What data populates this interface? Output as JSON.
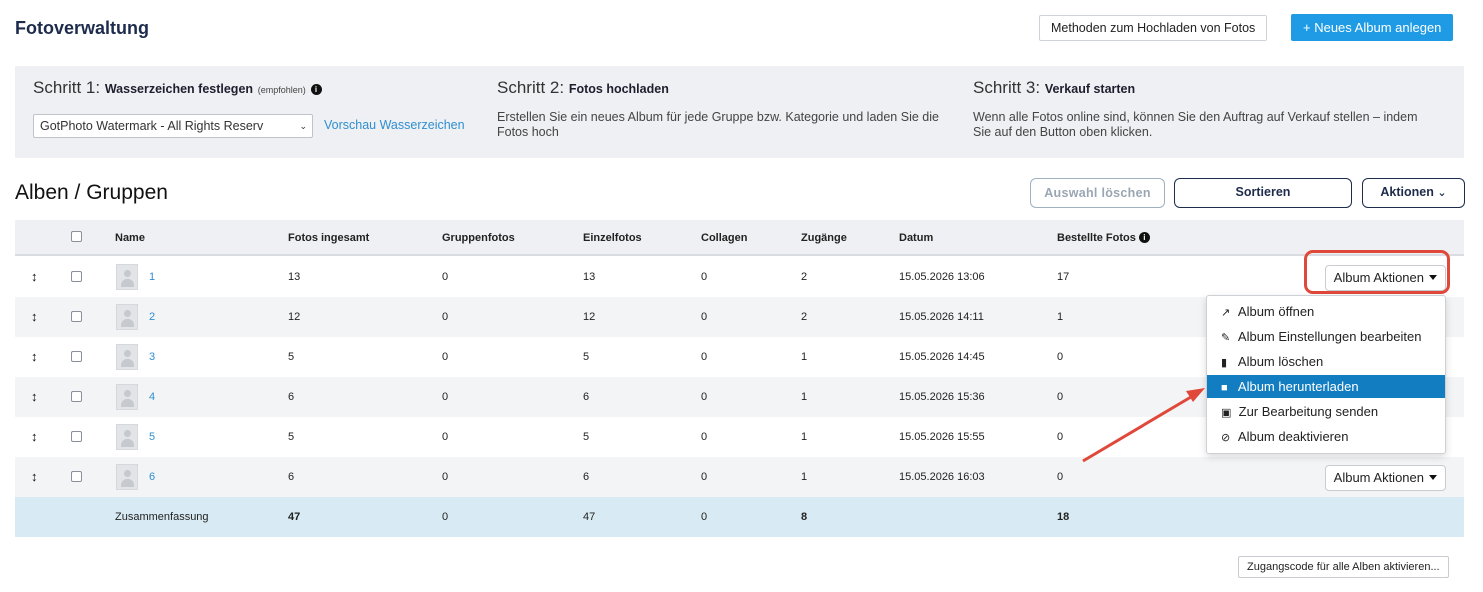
{
  "header": {
    "title": "Fotoverwaltung",
    "upload_methods_label": "Methoden zum Hochladen von Fotos",
    "new_album_label": "+ Neues Album anlegen"
  },
  "steps": [
    {
      "prefix": "Schritt 1:",
      "title": "Wasserzeichen festlegen",
      "note": "(empfohlen)"
    },
    {
      "prefix": "Schritt 2:",
      "title": "Fotos hochladen",
      "text": "Erstellen Sie ein neues Album für jede Gruppe bzw. Kategorie und laden Sie die Fotos hoch"
    },
    {
      "prefix": "Schritt 3:",
      "title": "Verkauf starten",
      "text": "Wenn alle Fotos online sind, können Sie den Auftrag auf Verkauf stellen – indem Sie auf den Button oben klicken."
    }
  ],
  "watermark": {
    "selected": "GotPhoto Watermark - All Rights Reserv",
    "preview_link": "Vorschau Wasserzeichen"
  },
  "albums": {
    "title": "Alben / Gruppen",
    "clear_selection_label": "Auswahl löschen",
    "sort_label": "Sortieren",
    "actions_label": "Aktionen"
  },
  "table": {
    "columns": [
      "Name",
      "Fotos ingesamt",
      "Gruppenfotos",
      "Einzelfotos",
      "Collagen",
      "Zugänge",
      "Datum",
      "Bestellte Fotos"
    ],
    "rows": [
      {
        "name": "1",
        "total": "13",
        "group": "0",
        "single": "13",
        "collages": "0",
        "access": "2",
        "date": "15.05.2026 13:06",
        "ordered": "17"
      },
      {
        "name": "2",
        "total": "12",
        "group": "0",
        "single": "12",
        "collages": "0",
        "access": "2",
        "date": "15.05.2026 14:11",
        "ordered": "1"
      },
      {
        "name": "3",
        "total": "5",
        "group": "0",
        "single": "5",
        "collages": "0",
        "access": "1",
        "date": "15.05.2026 14:45",
        "ordered": "0"
      },
      {
        "name": "4",
        "total": "6",
        "group": "0",
        "single": "6",
        "collages": "0",
        "access": "1",
        "date": "15.05.2026 15:36",
        "ordered": "0"
      },
      {
        "name": "5",
        "total": "5",
        "group": "0",
        "single": "5",
        "collages": "0",
        "access": "1",
        "date": "15.05.2026 15:55",
        "ordered": "0"
      },
      {
        "name": "6",
        "total": "6",
        "group": "0",
        "single": "6",
        "collages": "0",
        "access": "1",
        "date": "15.05.2026 16:03",
        "ordered": "0"
      }
    ],
    "summary": {
      "label": "Zusammenfassung",
      "total": "47",
      "group": "0",
      "single": "47",
      "collages": "0",
      "access": "8",
      "ordered": "18"
    },
    "album_actions_label": "Album Aktionen"
  },
  "album_menu": {
    "items": [
      {
        "label": "Album öffnen",
        "icon": "external-link-icon"
      },
      {
        "label": "Album Einstellungen bearbeiten",
        "icon": "pencil-icon"
      },
      {
        "label": "Album löschen",
        "icon": "trash-icon"
      },
      {
        "label": "Album herunterladen",
        "icon": "file-download-icon"
      },
      {
        "label": "Zur Bearbeitung senden",
        "icon": "edit-square-icon"
      },
      {
        "label": "Album deaktivieren",
        "icon": "ban-icon"
      }
    ],
    "active_index": 3
  },
  "footer": {
    "activate_codes_label": "Zugangscode für alle Alben aktivieren..."
  },
  "colors": {
    "primary": "#1e9be4",
    "highlight": "#e0483a",
    "menu_active": "#127dc0",
    "summary_bg": "#d8ebf4"
  }
}
